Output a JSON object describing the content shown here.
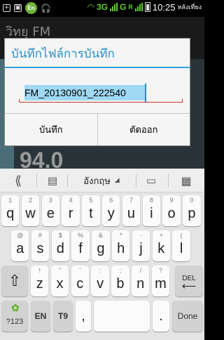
{
  "status_bar": {
    "en_badge": "En",
    "signal_3g": "3G",
    "signal_g": "G",
    "signal_r": "R",
    "time": "10:25",
    "ampm": "หลังเที่ยง"
  },
  "app": {
    "title": "วิทยุ FM",
    "frequency_partial": "94.0"
  },
  "dialog": {
    "title": "บันทึกไฟล์การบันทึก",
    "filename_value": "FM_20130901_222540",
    "save_label": "บันทึก",
    "cancel_label": "ตัดออก"
  },
  "keyboard": {
    "language": "อังกฤษ",
    "row1": [
      {
        "num": "1",
        "ch": "q"
      },
      {
        "num": "2",
        "ch": "w"
      },
      {
        "num": "3",
        "ch": "e"
      },
      {
        "num": "4",
        "ch": "r"
      },
      {
        "num": "5",
        "ch": "t"
      },
      {
        "num": "6",
        "ch": "y"
      },
      {
        "num": "7",
        "ch": "u"
      },
      {
        "num": "8",
        "ch": "i"
      },
      {
        "num": "9",
        "ch": "o"
      },
      {
        "num": "0",
        "ch": "p"
      }
    ],
    "row2": [
      {
        "sym": "@",
        "ch": "a"
      },
      {
        "sym": "#",
        "ch": "s"
      },
      {
        "sym": "$",
        "ch": "d"
      },
      {
        "sym": "%",
        "ch": "f"
      },
      {
        "sym": "&",
        "ch": "g"
      },
      {
        "sym": "*",
        "ch": "h"
      },
      {
        "sym": "-",
        "ch": "j"
      },
      {
        "sym": "+",
        "ch": "k"
      },
      {
        "sym": "(",
        "ch": "l"
      }
    ],
    "row3": [
      {
        "sym": "!",
        "ch": "z"
      },
      {
        "sym": "\"",
        "ch": "x"
      },
      {
        "sym": "'",
        "ch": "c"
      },
      {
        "sym": ":",
        "ch": "v"
      },
      {
        "sym": ";",
        "ch": "b"
      },
      {
        "sym": "/",
        "ch": "n"
      },
      {
        "sym": "?",
        "ch": "m"
      }
    ],
    "del_label": "DEL",
    "sym_label": "?123",
    "en_label": "EN",
    "t9_label": "T9",
    "comma_label": ",",
    "period_label": ".",
    "done_label": "Done"
  }
}
